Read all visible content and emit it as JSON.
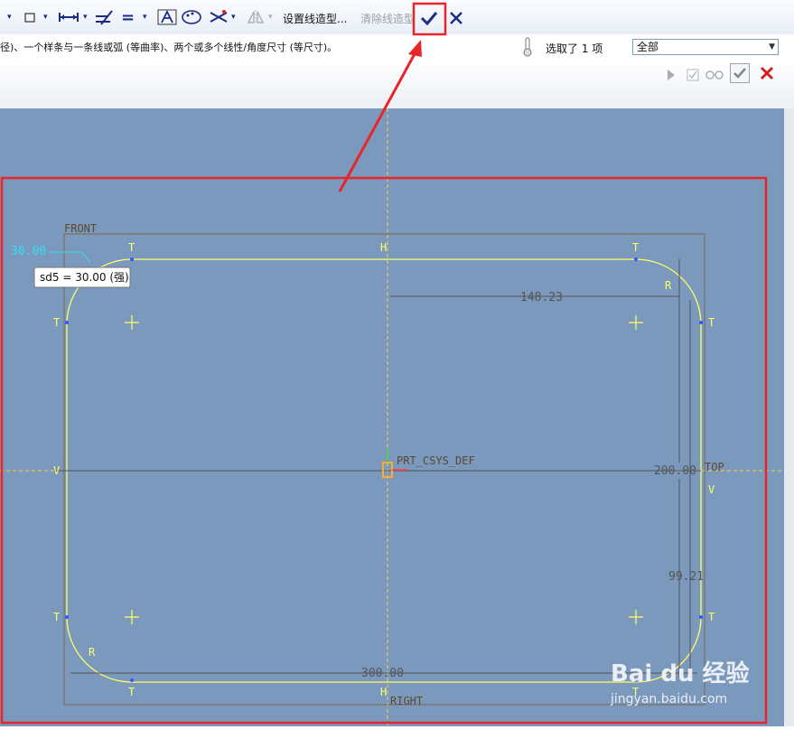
{
  "toolbar": {
    "set_linestyle_label": "设置线造型...",
    "clear_linestyle_label": "清除线造型",
    "equal_symbol": "="
  },
  "message": {
    "text": "径)、一个样条与一条线或弧 (等曲率)、两个或多个线性/角度尺寸 (等尺寸)。"
  },
  "selection": {
    "info": "选取了 1 项",
    "filter_value": "全部"
  },
  "sketch": {
    "front_label": "FRONT",
    "top_label": "TOP",
    "right_label": "RIGHT",
    "csys_label": "PRT_CSYS_DEF",
    "dim_top_value": "30.00",
    "tooltip": "sd5 = 30.00 (强)",
    "dim_148": "148.23",
    "dim_200": "200.00",
    "dim_99": "99.21",
    "dim_300": "300.00",
    "constraint_t": "T",
    "constraint_h": "H",
    "constraint_v": "V",
    "constraint_r": "R"
  },
  "colors": {
    "canvas_bg": "#7b98bd",
    "sketch_line": "#ffff66",
    "dimension": "#555555",
    "highlight": "#e8252a",
    "dim_cyan": "#33e0f0"
  },
  "watermark": {
    "brand": "Bai du 经验",
    "url": "jingyan.baidu.com"
  }
}
